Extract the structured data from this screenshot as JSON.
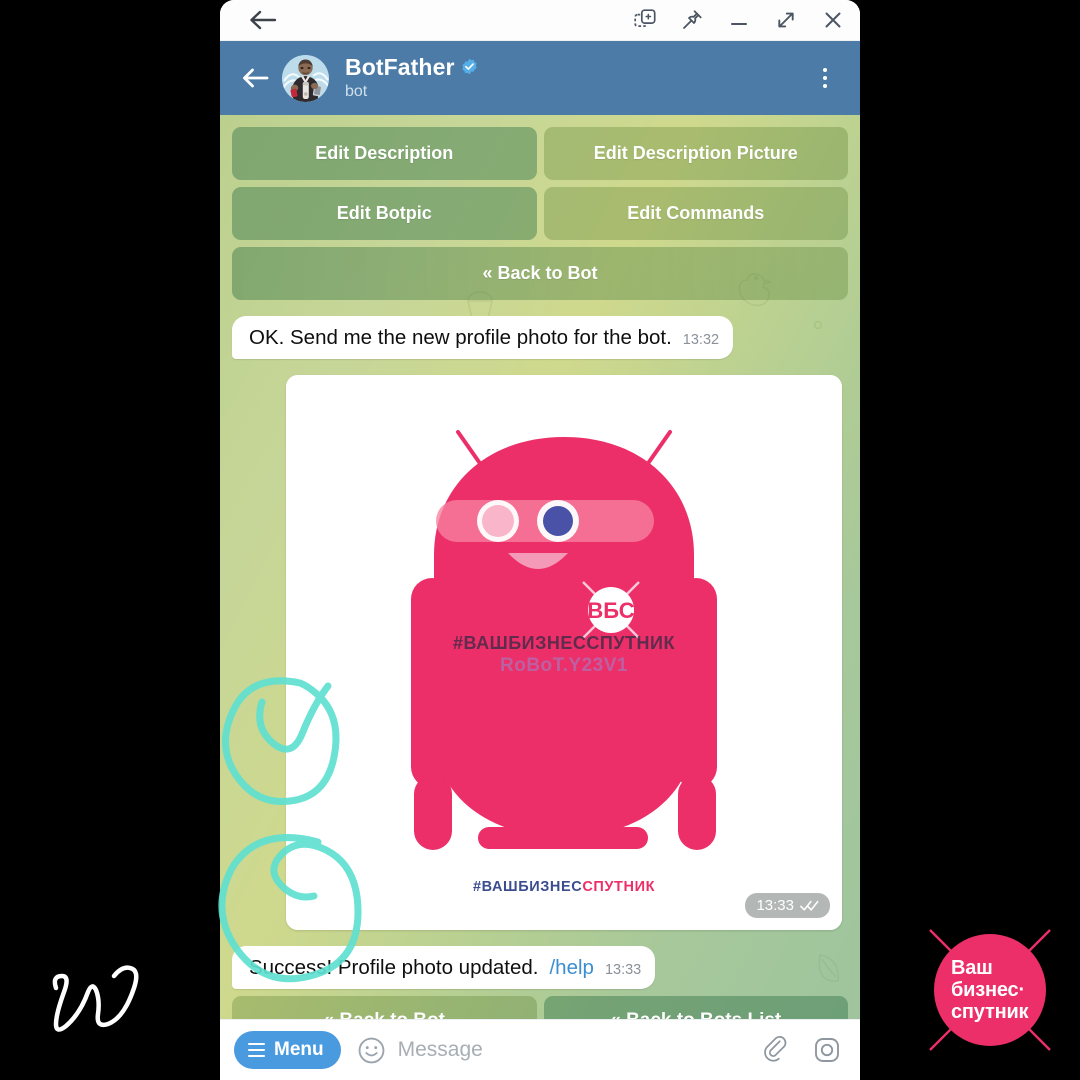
{
  "window": {
    "titlebar": {
      "back_icon": "arrow-left-icon",
      "controls": [
        {
          "name": "screenshot-icon",
          "label": "Screenshot"
        },
        {
          "name": "pin-icon",
          "label": "Pin"
        },
        {
          "name": "minimize-icon",
          "label": "Minimize"
        },
        {
          "name": "maximize-icon",
          "label": "Maximize"
        },
        {
          "name": "close-icon",
          "label": "Close"
        }
      ]
    }
  },
  "chat_header": {
    "back_icon": "arrow-left-icon",
    "name": "BotFather",
    "subtitle": "bot",
    "verified": true,
    "verified_icon": "verified-badge-icon",
    "menu_icon": "more-vertical-icon",
    "bg_color": "#4b7ba6"
  },
  "keyboard_top": {
    "rows": [
      [
        {
          "label": "Edit Description"
        },
        {
          "label": "Edit Description Picture"
        }
      ],
      [
        {
          "label": "Edit Botpic"
        },
        {
          "label": "Edit Commands"
        }
      ],
      [
        {
          "label": "« Back to Bot"
        }
      ]
    ]
  },
  "messages": [
    {
      "type": "text",
      "text": "OK. Send me the new profile photo for the bot.",
      "time": "13:32",
      "direction": "in"
    },
    {
      "type": "photo",
      "time": "13:33",
      "direction": "out",
      "status_icon": "double-check-icon",
      "caption_parts": [
        {
          "text": "#ВАШБИЗНЕС",
          "color": "#3b4d8f"
        },
        {
          "text": "СПУТНИК",
          "color": "#ec2f69"
        }
      ],
      "badge_text": "ВБС",
      "body_hashtag": "#ВАШБИЗНЕССПУТНИК",
      "watermark": "RoBoT.Y23V1",
      "robot_color": "#ec2f69"
    },
    {
      "type": "text",
      "text": "Success! Profile photo updated.",
      "command": "/help",
      "time": "13:33",
      "direction": "in"
    }
  ],
  "keyboard_bottom": {
    "buttons": [
      {
        "label": "« Back to Bot"
      },
      {
        "label": "« Back to Bots List"
      }
    ]
  },
  "composer": {
    "menu_label": "Menu",
    "menu_icon": "hamburger-icon",
    "emoji_icon": "smiley-icon",
    "placeholder": "Message",
    "attach_icon": "paperclip-icon",
    "camera_icon": "camera-icon",
    "menu_color": "#4a9ae0"
  },
  "brand_badge": {
    "line1": "Ваш",
    "line2": "бизнес·",
    "line3": "спутник",
    "color": "#ec2f69"
  },
  "annotations": {
    "marker_color": "#5fe0d0",
    "shapes": [
      "circled-checkmark",
      "circle-highlight"
    ],
    "signature": "W"
  }
}
